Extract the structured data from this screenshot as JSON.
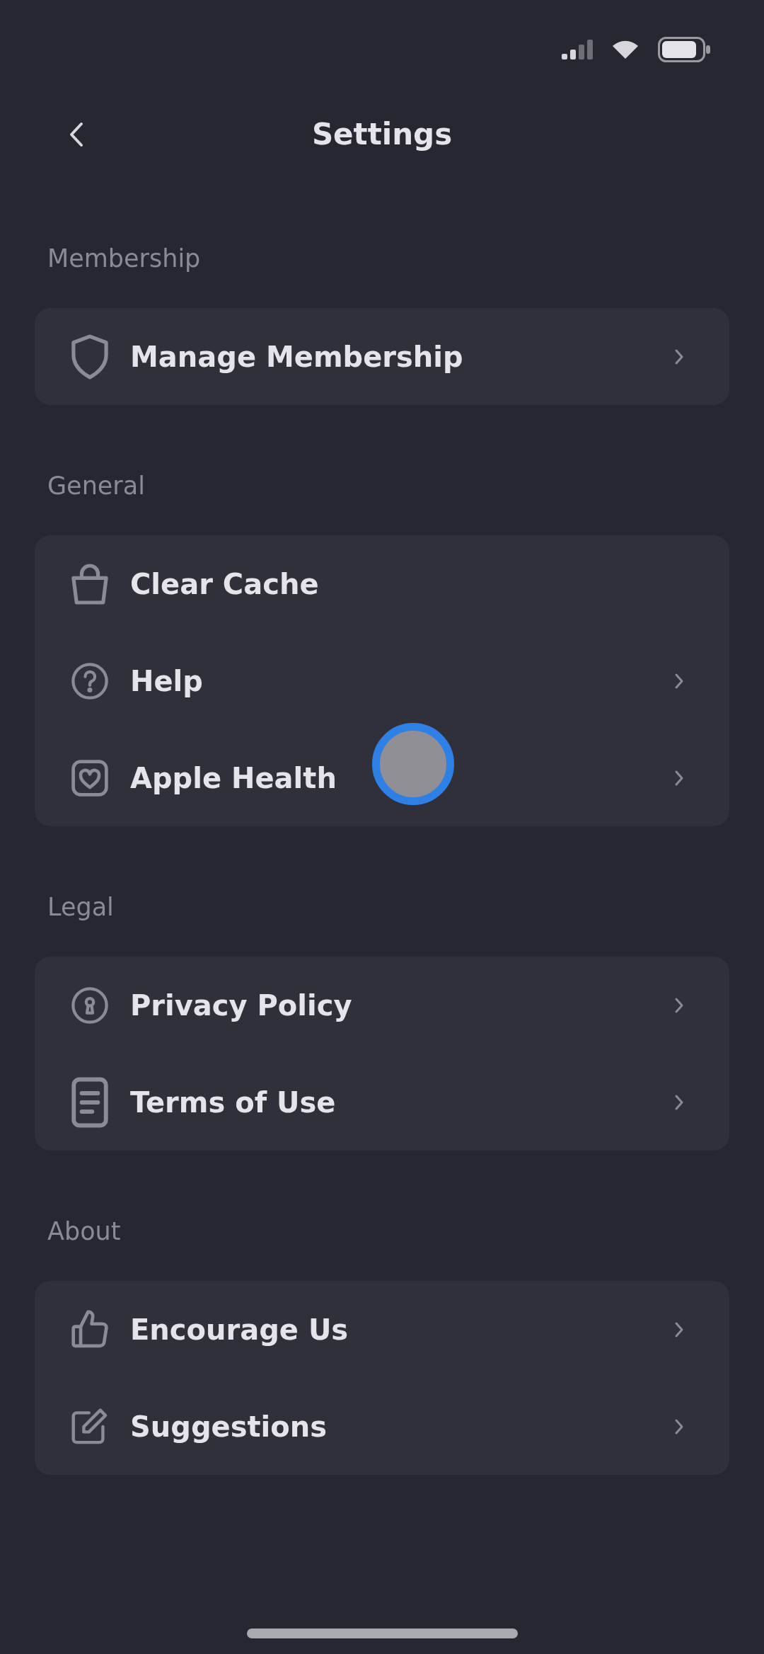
{
  "header": {
    "title": "Settings"
  },
  "sections": [
    {
      "title": "Membership",
      "items": [
        {
          "label": "Manage Membership",
          "kind": "link"
        }
      ]
    },
    {
      "title": "General",
      "items": [
        {
          "label": "Clear Cache",
          "kind": "action"
        },
        {
          "label": "Help",
          "kind": "link"
        },
        {
          "label": "Apple Health",
          "kind": "link"
        }
      ]
    },
    {
      "title": "Legal",
      "items": [
        {
          "label": "Privacy Policy",
          "kind": "link"
        },
        {
          "label": "Terms of Use",
          "kind": "link"
        }
      ]
    },
    {
      "title": "About",
      "items": [
        {
          "label": "Encourage Us",
          "kind": "link"
        },
        {
          "label": "Suggestions",
          "kind": "link"
        }
      ]
    }
  ]
}
